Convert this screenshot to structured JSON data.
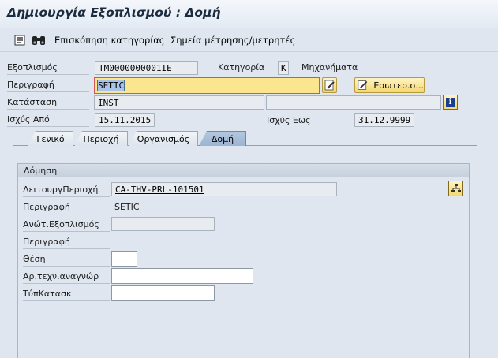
{
  "title": "Δημιουργία Εξοπλισμού : Δομή",
  "toolbar": {
    "detail_icon": "list-detail-icon",
    "binoculars_icon": "binoculars-icon",
    "category_overview": "Επισκόπηση κατηγορίας",
    "measuring_points": "Σημεία μέτρησης/μετρητές"
  },
  "header": {
    "equipment_label": "Εξοπλισμός",
    "equipment_value": "TM0000000001IE",
    "category_label": "Κατηγορία",
    "category_value": "K",
    "category_text": "Μηχανήματα",
    "description_label": "Περιγραφή",
    "description_value": "SETIC",
    "internal_note_button": "Εσωτερ.σ...",
    "status_label": "Κατάσταση",
    "status_value": "INST",
    "valid_from_label": "Ισχύς Από",
    "valid_from_value": "15.11.2015",
    "valid_to_label": "Ισχύς Εως",
    "valid_to_value": "31.12.9999"
  },
  "tabs": [
    {
      "label": "Γενικό",
      "active": false
    },
    {
      "label": "Περιοχή",
      "active": false
    },
    {
      "label": "Οργανισμός",
      "active": false
    },
    {
      "label": "Δομή",
      "active": true
    }
  ],
  "structure": {
    "group_title": "Δόμηση",
    "functional_location_label": "ΛειτουργΠεριοχή",
    "functional_location_value": "CA-THV-PRL-101501",
    "description_label": "Περιγραφή",
    "description_value": "SETIC",
    "superior_equipment_label": "Ανώτ.Εξοπλισμός",
    "superior_equipment_value": "",
    "description2_label": "Περιγραφή",
    "position_label": "Θέση",
    "position_value": "",
    "tech_id_label": "Αρ.τεχν.αναγνώρ",
    "tech_id_value": "",
    "construction_type_label": "ΤύπΚατασκ",
    "construction_type_value": ""
  },
  "colors": {
    "active_tab": "#9bb4d0",
    "focused_field": "#fbe68f",
    "focus_border": "#d9534f",
    "button": "#f5d86f"
  }
}
